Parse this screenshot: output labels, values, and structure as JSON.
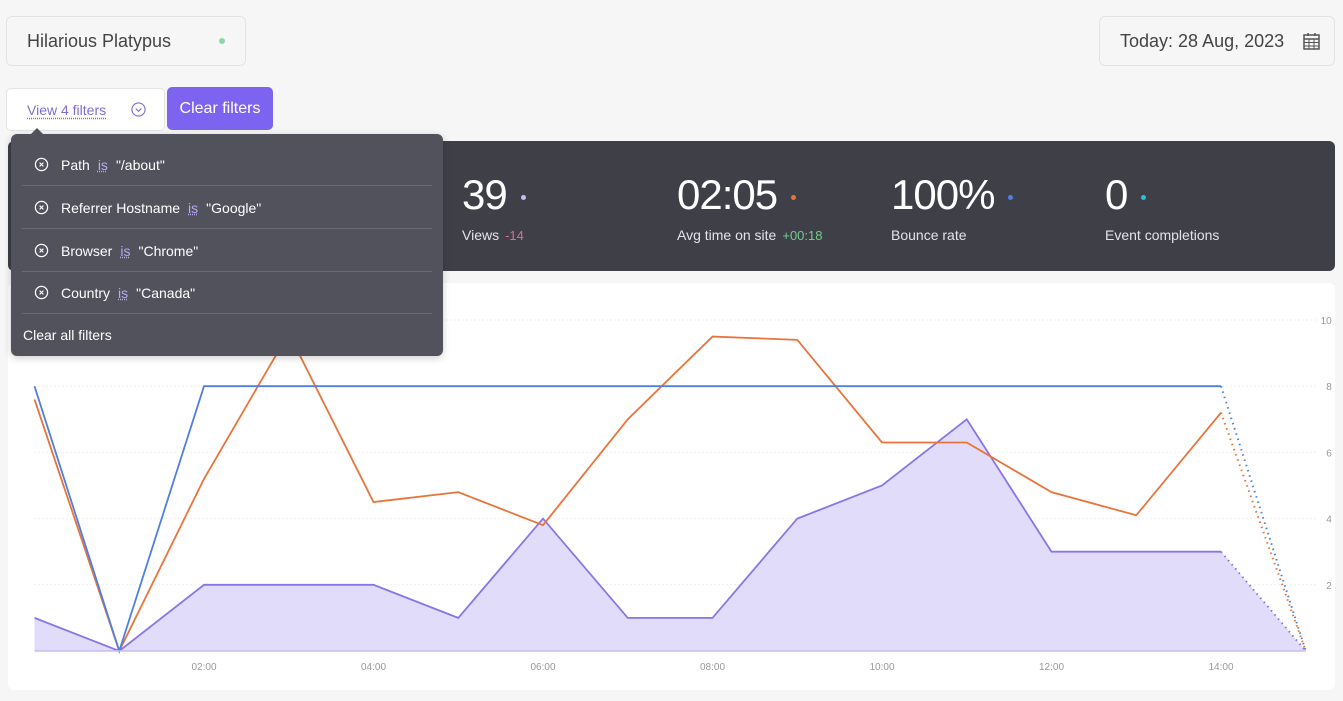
{
  "site": {
    "name": "Hilarious Platypus",
    "status_color": "#86dba4"
  },
  "date": {
    "label": "Today: 28 Aug, 2023",
    "icon": "calendar-icon"
  },
  "filters": {
    "toggle_label": "View 4 filters",
    "clear_label": "Clear filters",
    "clear_all_label": "Clear all filters",
    "items": [
      {
        "field": "Path",
        "op": "is",
        "value": "\"/about\""
      },
      {
        "field": "Referrer Hostname",
        "op": "is",
        "value": "\"Google\""
      },
      {
        "field": "Browser",
        "op": "is",
        "value": "\"Chrome\""
      },
      {
        "field": "Country",
        "op": "is",
        "value": "\"Canada\""
      }
    ]
  },
  "stats": [
    {
      "value": "39",
      "label": "Views",
      "delta": "-14",
      "delta_color": "#e06a9a",
      "dot": "#c8bdf5"
    },
    {
      "value": "02:05",
      "label": "Avg time on site",
      "delta": "+00:18",
      "delta_color": "#6fcf8a",
      "dot": "#e8743b"
    },
    {
      "value": "100%",
      "label": "Bounce rate",
      "delta": "",
      "dot": "#4f7fe0"
    },
    {
      "value": "0",
      "label": "Event completions",
      "delta": "",
      "dot": "#22c4e0"
    }
  ],
  "chart_data": {
    "type": "line",
    "x": [
      0,
      1,
      2,
      3,
      4,
      5,
      6,
      7,
      8,
      9,
      10,
      11,
      12,
      13,
      14,
      15
    ],
    "x_tick_labels": [
      "02:00",
      "04:00",
      "06:00",
      "08:00",
      "10:00",
      "12:00",
      "14:00"
    ],
    "x_ticks": [
      2,
      4,
      6,
      8,
      10,
      12,
      14
    ],
    "y_ticks": [
      2,
      4,
      6,
      8,
      10
    ],
    "ylim": [
      0,
      10
    ],
    "grid": true,
    "y_axis_position": "right",
    "projected_from_index": 14,
    "series": [
      {
        "color": "#8b74e8",
        "fill": "#e2dcfb",
        "values": [
          1,
          0,
          2,
          2,
          2,
          1,
          4,
          1,
          1,
          4,
          5,
          7,
          3,
          3,
          3,
          0
        ]
      },
      {
        "color": "#e8743b",
        "values": [
          7.6,
          0,
          5.2,
          9.6,
          4.5,
          4.8,
          3.8,
          7.0,
          9.5,
          9.4,
          6.3,
          6.3,
          4.8,
          4.1,
          7.2,
          0
        ]
      },
      {
        "color": "#4f7fe0",
        "values": [
          8,
          0,
          8,
          8,
          8,
          8,
          8,
          8,
          8,
          8,
          8,
          8,
          8,
          8,
          8,
          0
        ]
      }
    ]
  }
}
